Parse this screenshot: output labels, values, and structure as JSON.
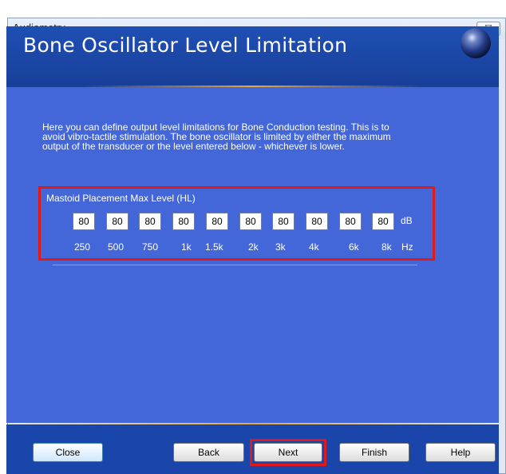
{
  "window": {
    "title": "Audiometry",
    "close_glyph": "☒"
  },
  "header": {
    "title": "Bone Oscillator Level Limitation",
    "icon": "blue-orb-icon"
  },
  "description": "Here you can define output level limitations for Bone Conduction testing. This is to avoid vibro-tactile stimulation. The bone oscillator is limited by either the maximum output of the transducer or the level entered below - whichever is lower.",
  "mastoid": {
    "label": "Mastoid Placement Max Level (HL)",
    "levels": [
      "80",
      "80",
      "80",
      "80",
      "80",
      "80",
      "80",
      "80",
      "80",
      "80"
    ],
    "level_unit": "dB",
    "frequencies": [
      "250",
      "500",
      "750",
      "1k",
      "1.5k",
      "2k",
      "3k",
      "4k",
      "6k",
      "8k"
    ],
    "frequency_unit": "Hz"
  },
  "buttons": {
    "close": "Close",
    "back": "Back",
    "next": "Next",
    "finish": "Finish",
    "help": "Help"
  },
  "colors": {
    "panel_blue": "#4367d9",
    "header_blue": "#1f4fb4",
    "highlight_red": "#e01919",
    "accent_gold": "#e8a83c"
  }
}
